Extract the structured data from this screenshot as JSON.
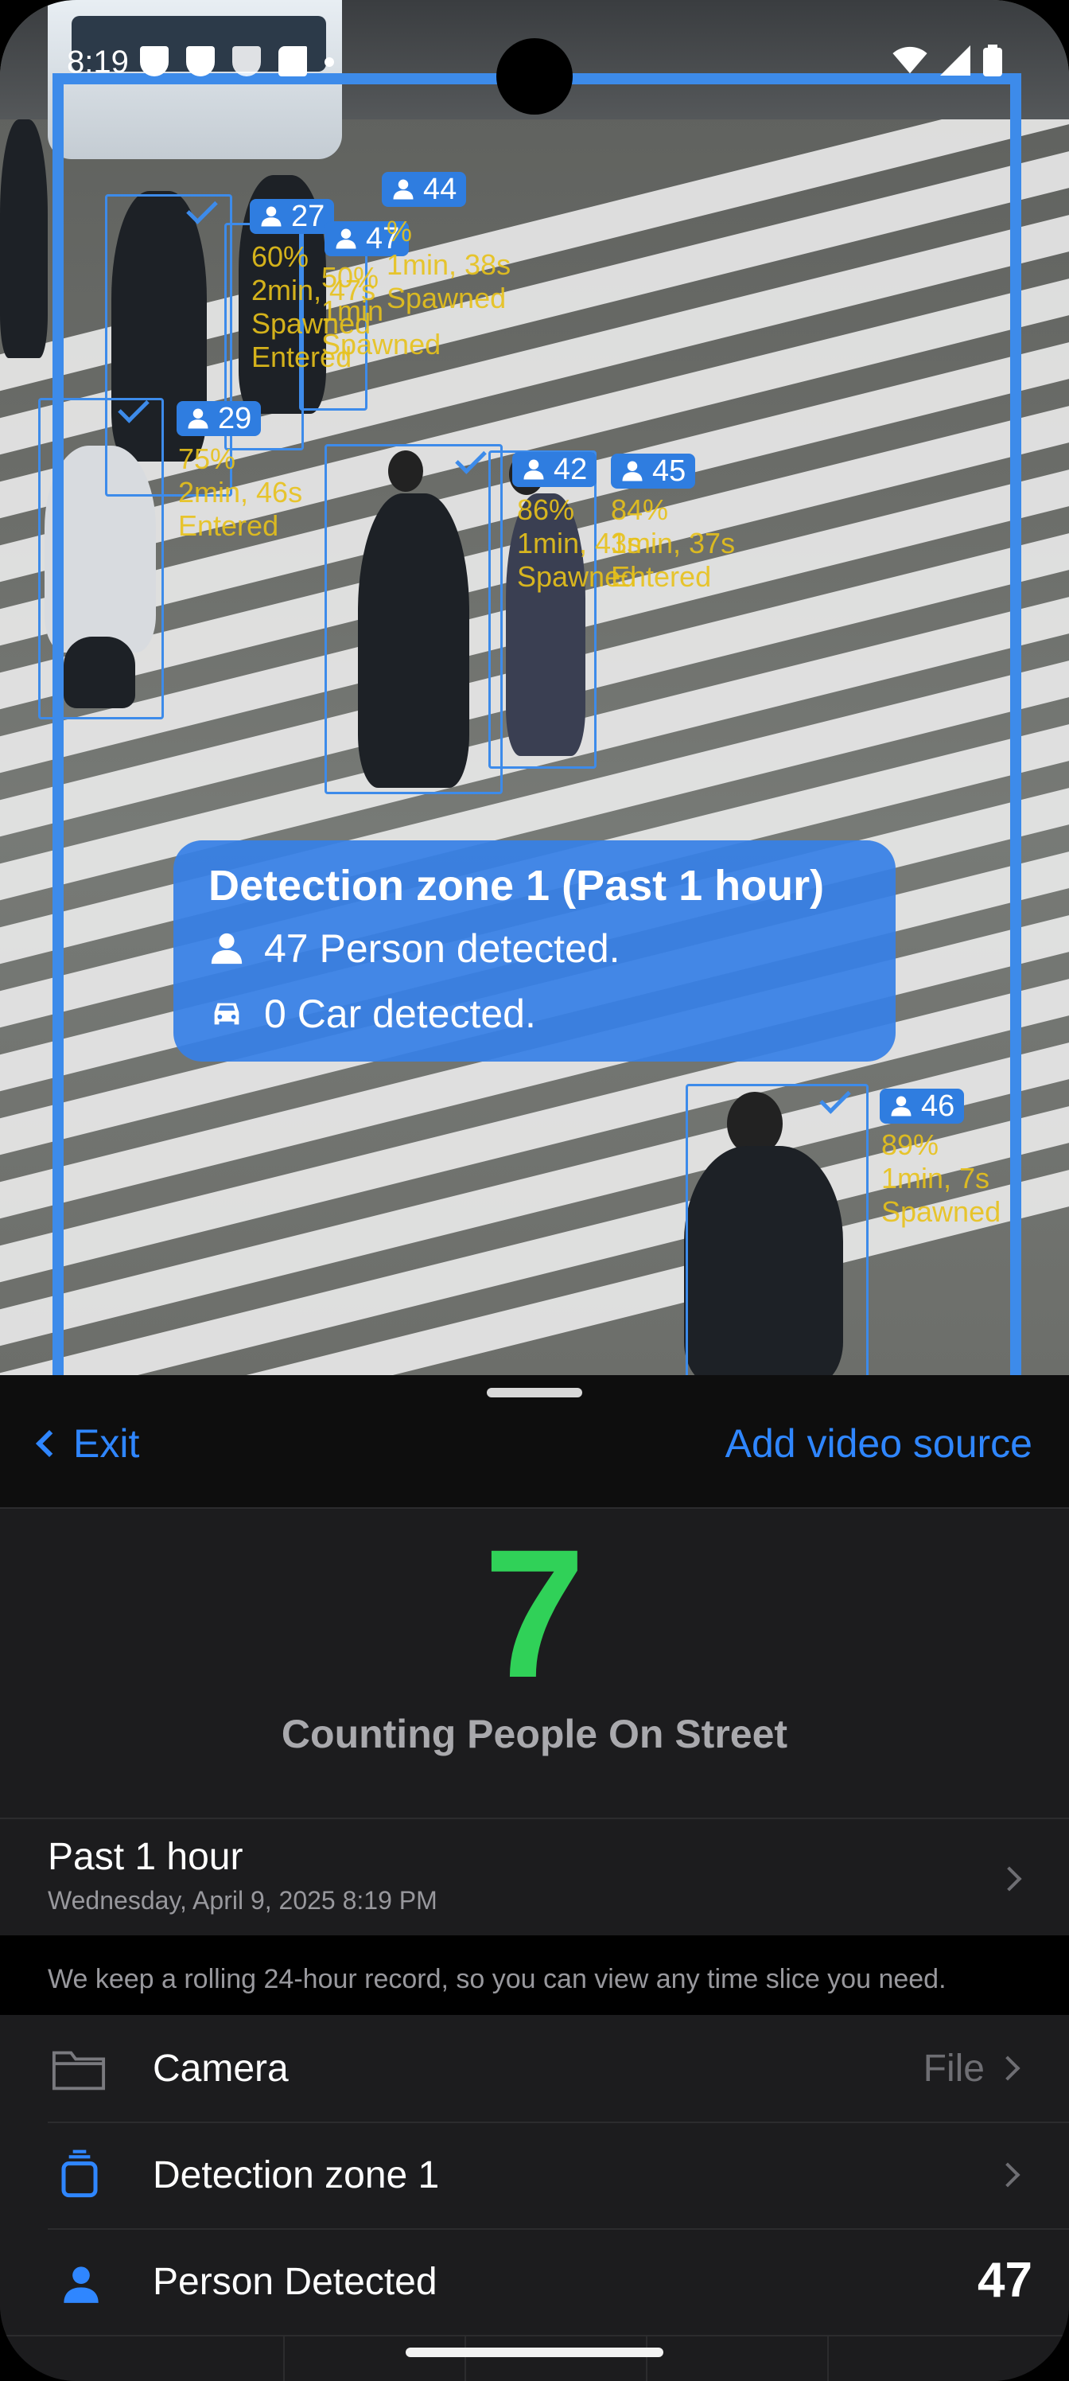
{
  "status_bar": {
    "time": "8:19"
  },
  "detections": [
    {
      "id": "44",
      "meta": "%\n1min, 38s\nSpawned"
    },
    {
      "id": "27",
      "meta": "60%\n2min, 47s\nSpawned\nEntered"
    },
    {
      "id": "47",
      "meta": "50%\n1min\nSpawned"
    },
    {
      "id": "29",
      "meta": "75%\n2min, 46s\nEntered"
    },
    {
      "id": "42",
      "meta": "86%\n1min, 43s\nSpawned"
    },
    {
      "id": "45",
      "meta": "84%\n1min, 37s\nEntered"
    },
    {
      "id": "46",
      "meta": "89%\n1min, 7s\nSpawned"
    }
  ],
  "summary": {
    "title": "Detection zone 1 (Past 1 hour)",
    "person_line": "47 Person detected.",
    "car_line": "0 Car detected."
  },
  "nav": {
    "back_label": "Exit",
    "add_label": "Add video source"
  },
  "counter": {
    "value": "7",
    "title": "Counting People On Street"
  },
  "time_range": {
    "title": "Past 1 hour",
    "subtitle": "Wednesday, April 9, 2025 8:19 PM"
  },
  "note": "We keep a rolling 24-hour record, so you can view any time slice you need.",
  "settings": {
    "camera_label": "Camera",
    "camera_value": "File",
    "zone_label": "Detection zone 1",
    "person_label": "Person Detected",
    "person_count": "47"
  },
  "colors": {
    "accent": "#2f86ff",
    "count_green": "#30d158",
    "box_blue": "#3d8bea",
    "meta_yellow": "#e8c21a"
  }
}
